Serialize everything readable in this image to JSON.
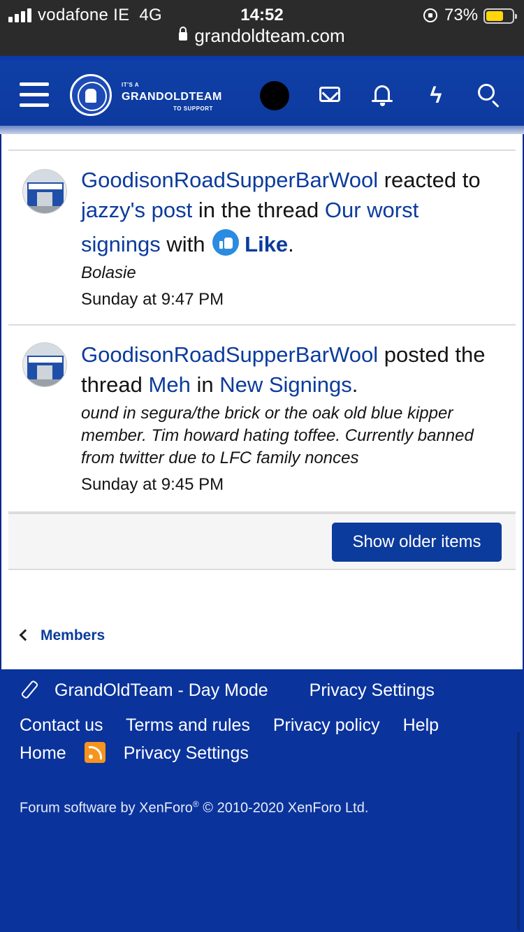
{
  "status_bar": {
    "carrier": "vodafone IE",
    "network": "4G",
    "time": "14:52",
    "battery_percent": "73%",
    "battery_level": 0.73
  },
  "browser": {
    "url": "grandoldteam.com"
  },
  "header": {
    "logo_top": "IT'S A",
    "logo_main": "GRANDOLDTEAM",
    "logo_bottom": "TO SUPPORT",
    "icons": [
      "menu-icon",
      "mail-icon",
      "bell-icon",
      "bolt-icon",
      "search-icon"
    ]
  },
  "feed": [
    {
      "user": "GoodisonRoadSupperBarWool",
      "verb": "reacted",
      "to": "to",
      "target": "jazzy's post",
      "in_the_thread": "in the thread",
      "thread": "Our worst signings",
      "with": "with",
      "reaction": "Like",
      "snippet": "Bolasie",
      "time": "Sunday at 9:47 PM"
    },
    {
      "user": "GoodisonRoadSupperBarWool",
      "verb": "posted",
      "the_thread": "the thread",
      "thread": "Meh",
      "in": "in",
      "forum": "New Signings",
      "snippet": "ound in segura/the brick or the oak old blue kipper member. Tim howard hating toffee. Currently banned from twitter due to LFC family nonces",
      "time": "Sunday at 9:45 PM"
    }
  ],
  "older_button": "Show older items",
  "breadcrumb": "Members",
  "footer": {
    "style_chooser": "GrandOldTeam - Day Mode",
    "privacy_settings_top": "Privacy Settings",
    "links_row1": [
      "Contact us",
      "Terms and rules",
      "Privacy policy",
      "Help"
    ],
    "home": "Home",
    "privacy_settings_bottom": "Privacy Settings",
    "copyright_prefix": "Forum software by XenForo",
    "registered": "®",
    "copyright_suffix": " © 2010-2020 XenForo Ltd.",
    "colors": {
      "footer_bg": "#0a339c",
      "link": "#0b3b9c",
      "rss": "#f7941d"
    }
  }
}
